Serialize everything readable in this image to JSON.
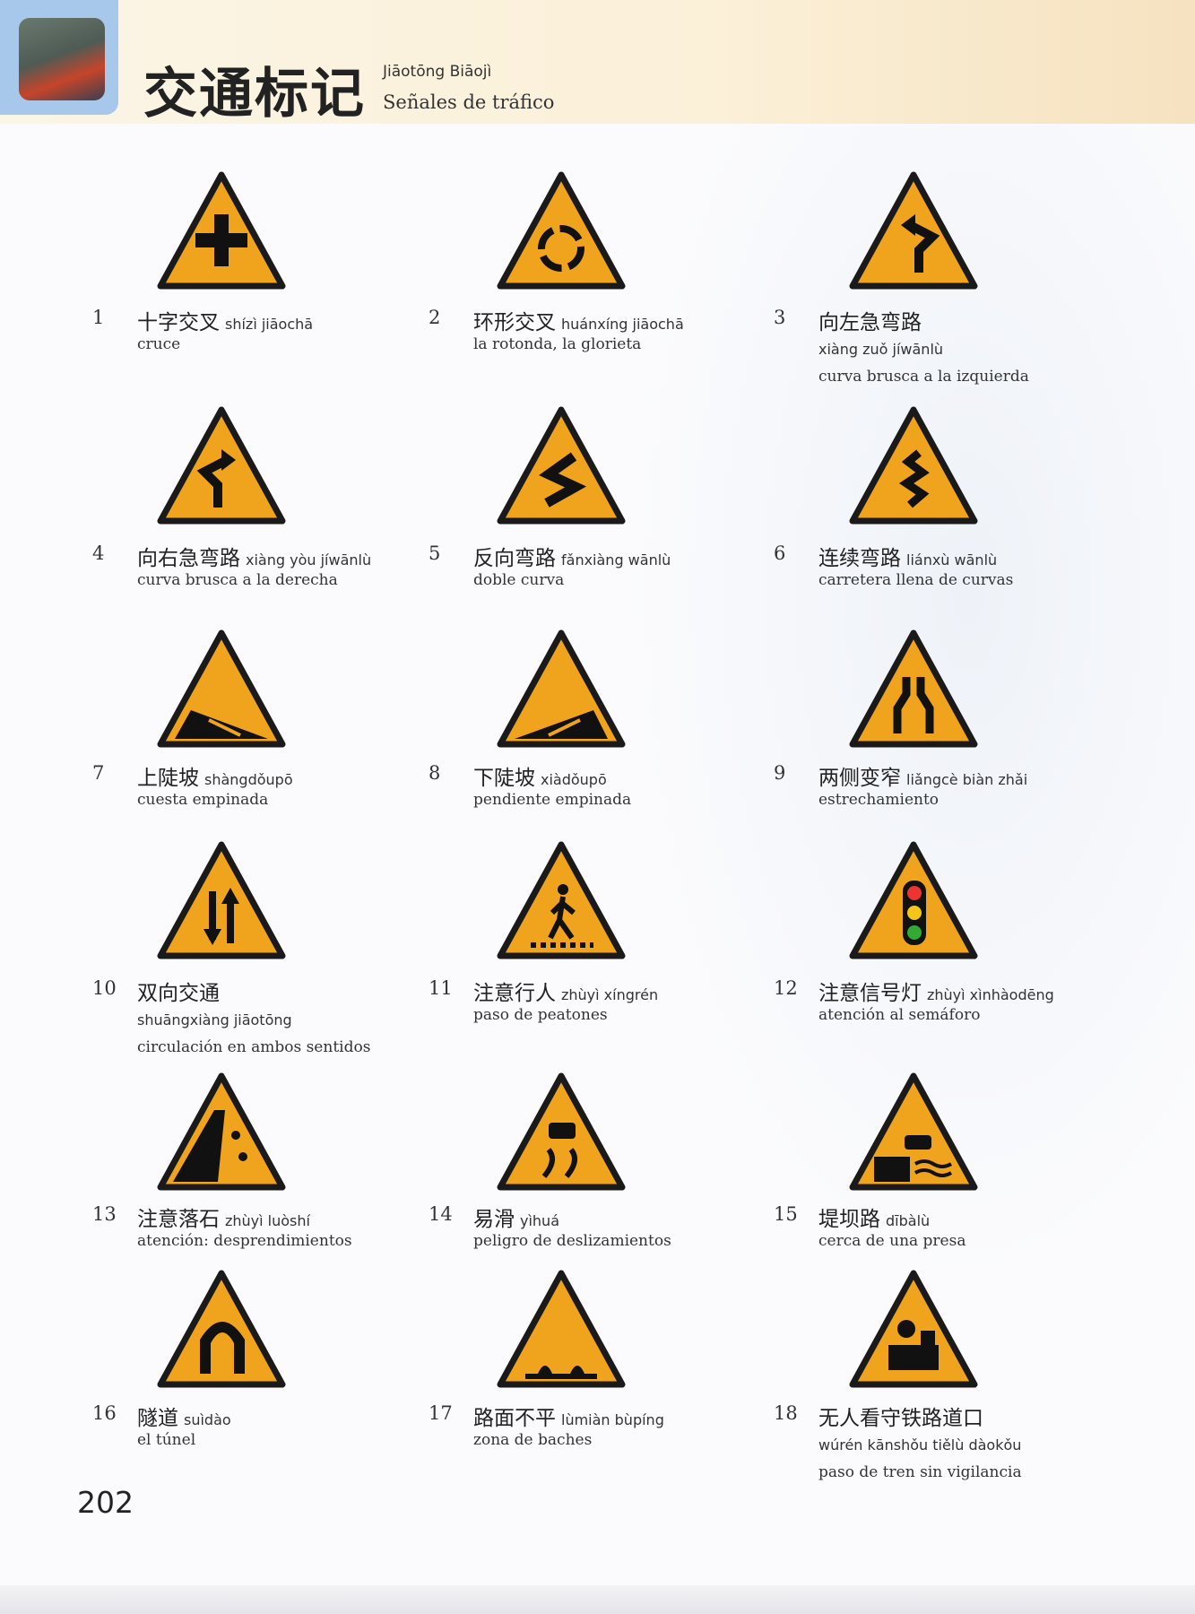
{
  "header": {
    "title": "交通标记",
    "title_pinyin": "Jiāotōng Biāojì",
    "title_es": "Señales de tráfico"
  },
  "colors": {
    "sign_fill": "#f0a31c",
    "sign_border": "#1a1a1a"
  },
  "items": [
    {
      "num": "1",
      "cn": "十字交叉",
      "py": "shízì jiāochā",
      "es": "cruce",
      "icon": "crossroad-icon"
    },
    {
      "num": "2",
      "cn": "环形交叉",
      "py": "huánxíng jiāochā",
      "es": "la rotonda, la glorieta",
      "icon": "roundabout-icon"
    },
    {
      "num": "3",
      "cn": "向左急弯路",
      "py": "xiàng zuǒ jíwānlù",
      "es": "curva brusca a la izquierda",
      "icon": "sharp-left-curve-icon",
      "py_newline": true
    },
    {
      "num": "4",
      "cn": "向右急弯路",
      "py": "xiàng yòu jíwānlù",
      "es": "curva brusca a la derecha",
      "icon": "sharp-right-curve-icon"
    },
    {
      "num": "5",
      "cn": "反向弯路",
      "py": "fǎnxiàng wānlù",
      "es": "doble curva",
      "icon": "double-curve-icon"
    },
    {
      "num": "6",
      "cn": "连续弯路",
      "py": "liánxù wānlù",
      "es": "carretera llena de curvas",
      "icon": "winding-road-icon"
    },
    {
      "num": "7",
      "cn": "上陡坡",
      "py": "shàngdǒupō",
      "es": "cuesta empinada",
      "icon": "steep-ascent-icon"
    },
    {
      "num": "8",
      "cn": "下陡坡",
      "py": "xiàdǒupō",
      "es": "pendiente empinada",
      "icon": "steep-descent-icon"
    },
    {
      "num": "9",
      "cn": "两侧变窄",
      "py": "liǎngcè biàn zhǎi",
      "es": "estrechamiento",
      "icon": "road-narrows-icon"
    },
    {
      "num": "10",
      "cn": "双向交通",
      "py": "shuāngxiàng jiāotōng",
      "es": "circulación en ambos sentidos",
      "icon": "two-way-traffic-icon",
      "py_newline": true
    },
    {
      "num": "11",
      "cn": "注意行人",
      "py": "zhùyì xíngrén",
      "es": "paso de peatones",
      "icon": "pedestrian-icon"
    },
    {
      "num": "12",
      "cn": "注意信号灯",
      "py": "zhùyì xìnhàodēng",
      "es": "atención al semáforo",
      "icon": "traffic-light-icon"
    },
    {
      "num": "13",
      "cn": "注意落石",
      "py": "zhùyì luòshí",
      "es": "atención: desprendimientos",
      "icon": "falling-rocks-icon"
    },
    {
      "num": "14",
      "cn": "易滑",
      "py": "yìhuá",
      "es": "peligro de deslizamientos",
      "icon": "slippery-road-icon"
    },
    {
      "num": "15",
      "cn": "堤坝路",
      "py": "dībàlù",
      "es": "cerca de una presa",
      "icon": "embankment-icon"
    },
    {
      "num": "16",
      "cn": "隧道",
      "py": "suìdào",
      "es": "el túnel",
      "icon": "tunnel-icon"
    },
    {
      "num": "17",
      "cn": "路面不平",
      "py": "lùmiàn bùpíng",
      "es": "zona de baches",
      "icon": "uneven-road-icon"
    },
    {
      "num": "18",
      "cn": "无人看守铁路道口",
      "py": "wúrén kānshǒu tiělù dàokǒu",
      "es": "paso de tren sin vigilancia",
      "icon": "railway-crossing-icon",
      "py_newline": true
    }
  ],
  "page_number": "202"
}
